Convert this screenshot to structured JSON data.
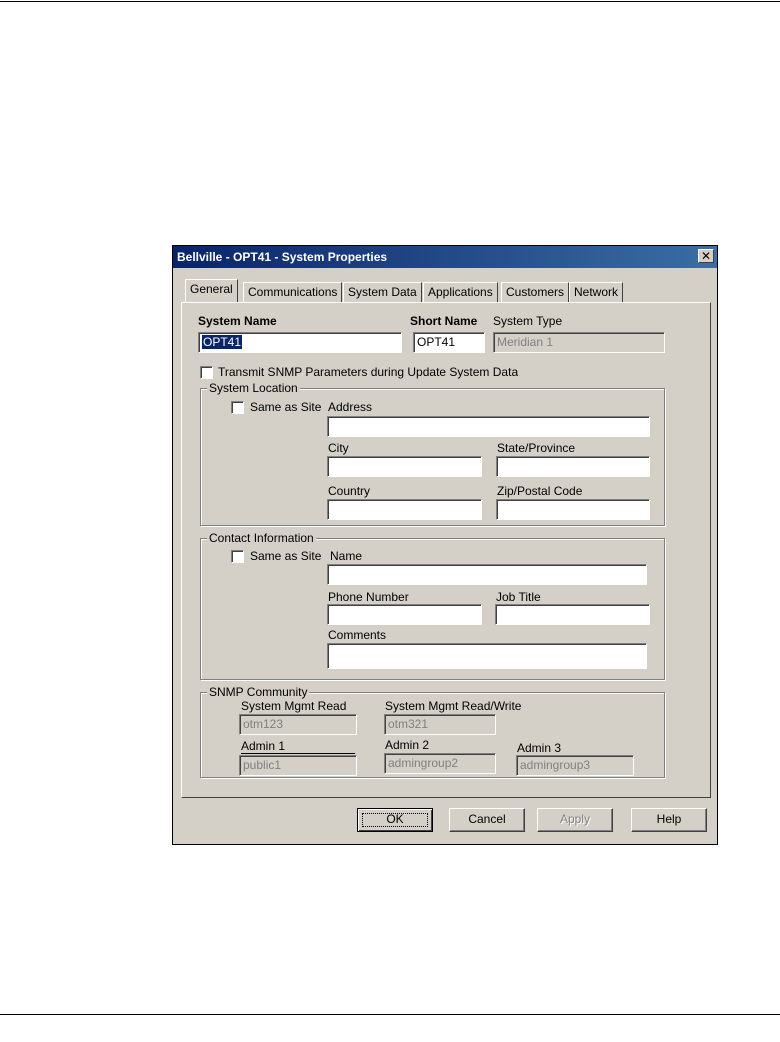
{
  "dialog": {
    "title": "Bellville - OPT41 - System Properties",
    "close_glyph": "✕"
  },
  "tabs": [
    "General",
    "Communications",
    "System Data",
    "Applications",
    "Customers",
    "Network"
  ],
  "general": {
    "system_name_label": "System Name",
    "system_name_value": "OPT41",
    "short_name_label": "Short Name",
    "short_name_value": "OPT41",
    "system_type_label": "System Type",
    "system_type_value": "Meridian 1",
    "transmit_snmp_label": "Transmit SNMP Parameters during Update System Data",
    "transmit_snmp_checked": false
  },
  "system_location": {
    "group_label": "System Location",
    "same_as_site_label": "Same as Site",
    "same_as_site_checked": false,
    "address_label": "Address",
    "address_value": "",
    "city_label": "City",
    "city_value": "",
    "state_label": "State/Province",
    "state_value": "",
    "country_label": "Country",
    "country_value": "",
    "zip_label": "Zip/Postal Code",
    "zip_value": ""
  },
  "contact_information": {
    "group_label": "Contact Information",
    "same_as_site_label": "Same as Site",
    "same_as_site_checked": false,
    "name_label": "Name",
    "name_value": "",
    "phone_label": "Phone Number",
    "phone_value": "",
    "job_title_label": "Job Title",
    "job_title_value": "",
    "comments_label": "Comments",
    "comments_value": ""
  },
  "snmp_community": {
    "group_label": "SNMP Community",
    "read_label": "System Mgmt Read",
    "read_value": "otm123",
    "read_write_label": "System Mgmt Read/Write",
    "read_write_value": "otm321",
    "admin1_label": "Admin 1",
    "admin1_value": "public1",
    "admin2_label": "Admin 2",
    "admin2_value": "admingroup2",
    "admin3_label": "Admin 3",
    "admin3_value": "admingroup3"
  },
  "buttons": {
    "ok": "OK",
    "cancel": "Cancel",
    "apply": "Apply",
    "help": "Help"
  },
  "colors": {
    "titlebar_start": "#0a246a",
    "titlebar_end": "#3a6ea5",
    "dialog_face": "#d4d0c8"
  }
}
